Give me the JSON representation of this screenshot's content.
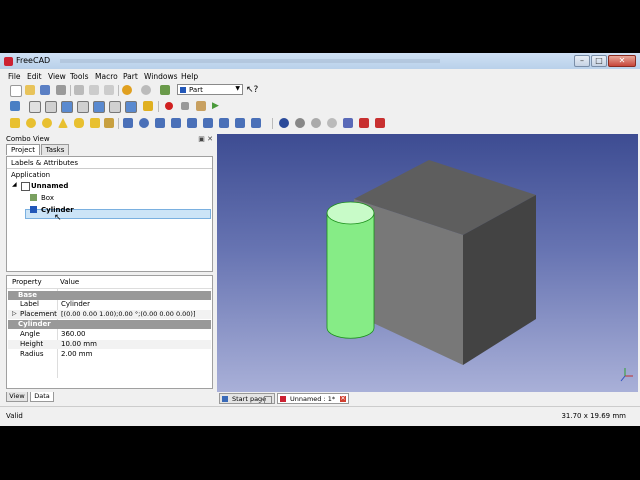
{
  "window": {
    "title": "FreeCAD",
    "colors": {
      "viewport_top": "#3d4c92",
      "viewport_bottom": "#a9b0d8",
      "cylinder": "#8bf08b"
    }
  },
  "menu": [
    "File",
    "Edit",
    "View",
    "Tools",
    "Macro",
    "Part",
    "Windows",
    "Help"
  ],
  "workbench": {
    "selected": "Part"
  },
  "combo_view": {
    "title": "Combo View",
    "tabs": [
      "Project",
      "Tasks"
    ],
    "tree_heading": "Labels & Attributes",
    "tree_section": "Application",
    "document": "Unnamed",
    "objects": [
      "Box",
      "Cylinder"
    ],
    "selected_object": "Cylinder"
  },
  "properties": {
    "headers": [
      "Property",
      "Value"
    ],
    "groups": [
      {
        "name": "Base",
        "rows": [
          {
            "name": "Label",
            "value": "Cylinder"
          },
          {
            "name": "Placement",
            "value": "[(0.00 0.00 1.00);0.00 °;(0.00 0.00 0.00)]"
          }
        ]
      },
      {
        "name": "Cylinder",
        "rows": [
          {
            "name": "Angle",
            "value": "360.00"
          },
          {
            "name": "Height",
            "value": "10.00 mm"
          },
          {
            "name": "Radius",
            "value": "2.00 mm"
          }
        ]
      }
    ],
    "bottom_tabs": [
      "View",
      "Data"
    ]
  },
  "doc_tabs": [
    "Start page",
    "Unnamed : 1*"
  ],
  "status": {
    "left": "Valid",
    "right": "31.70 x 19.69 mm"
  }
}
